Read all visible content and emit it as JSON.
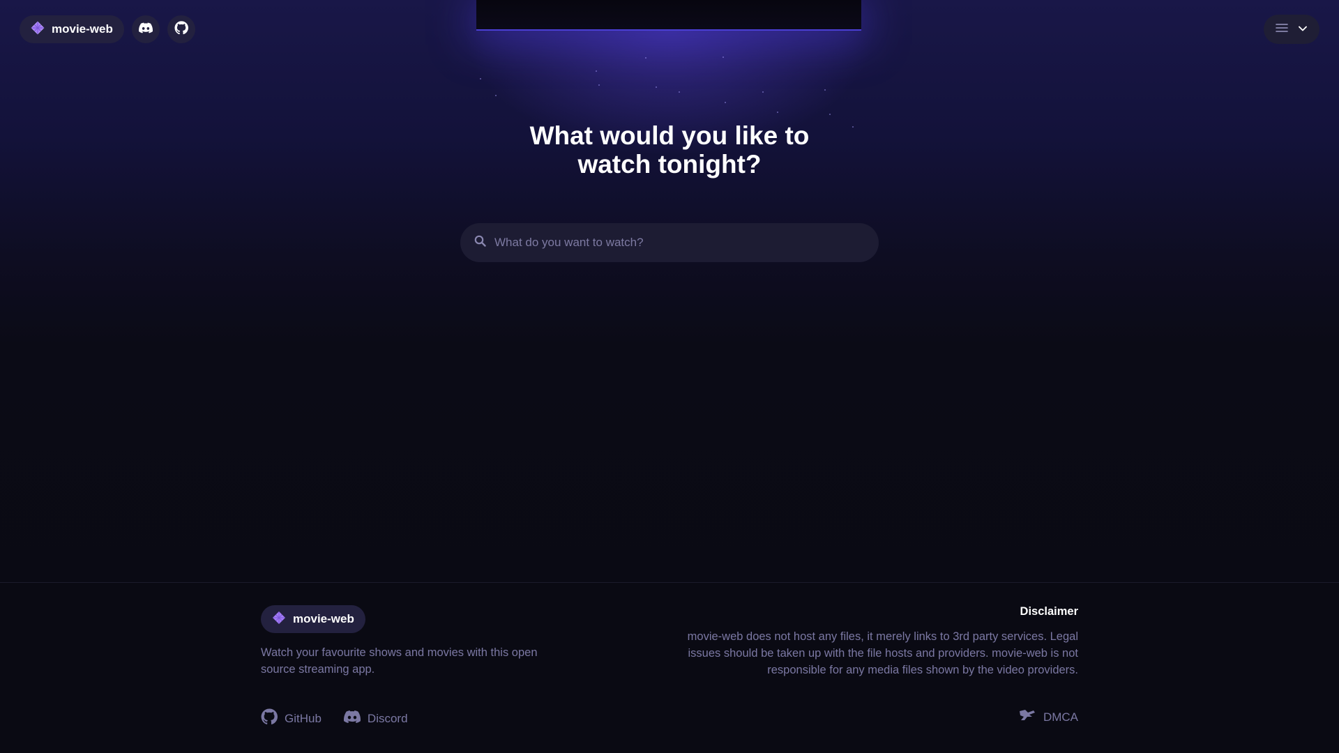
{
  "header": {
    "brand_label": "movie-web",
    "icons": [
      "diamond-logo-icon",
      "discord-icon",
      "github-icon",
      "hamburger-icon",
      "chevron-down-icon"
    ]
  },
  "hero": {
    "title_line1": "What would you like to",
    "title_line2": "watch tonight?"
  },
  "search": {
    "placeholder": "What do you want to watch?",
    "value": ""
  },
  "footer": {
    "brand_label": "movie-web",
    "tagline": "Watch your favourite shows and movies with this open source streaming app.",
    "links": {
      "github": "GitHub",
      "discord": "Discord",
      "dmca": "DMCA"
    },
    "disclaimer_title": "Disclaimer",
    "disclaimer_text": "movie-web does not host any files, it merely links to 3rd party services. Legal issues should be taken up with the file hosts and providers. movie-web is not responsible for any media files shown by the video providers."
  },
  "colors": {
    "accent": "#a37cf5",
    "pill_bg": "#23213f",
    "muted_text": "#7b78a3",
    "background": "#0a0a12"
  }
}
